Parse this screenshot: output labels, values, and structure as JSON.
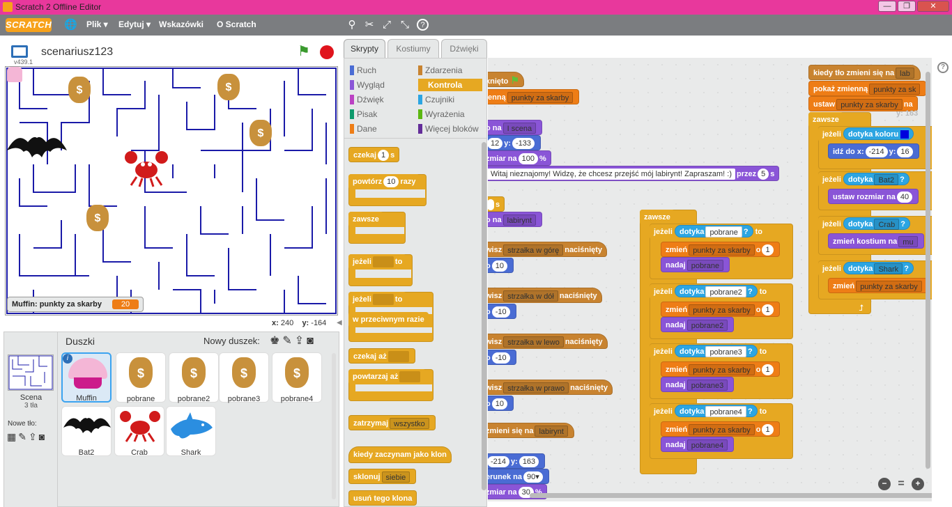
{
  "window": {
    "title": "Scratch 2 Offline Editor",
    "min": "—",
    "max": "❐",
    "close": "✕"
  },
  "menubar": {
    "logo": "SCRATCH",
    "items": [
      "Plik ▾",
      "Edytuj ▾",
      "Wskazówki",
      "O Scratch"
    ]
  },
  "stage": {
    "project_title": "scenariusz123",
    "version": "v439.1",
    "monitor_label": "Muffin: punkty za skarby",
    "monitor_value": "20",
    "x_label": "x:",
    "x_value": "240",
    "y_label": "y:",
    "y_value": "-164"
  },
  "sprites_pane": {
    "title": "Duszki",
    "new_sprite": "Nowy duszek:",
    "scene_label": "Scena",
    "scene_sub": "3 tła",
    "new_bg": "Nowe tło:",
    "sprites": [
      "Muffin",
      "pobrane",
      "pobrane2",
      "pobrane3",
      "pobrane4",
      "Bat2",
      "Crab",
      "Shark"
    ]
  },
  "tabs": [
    "Skrypty",
    "Kostiumy",
    "Dźwięki"
  ],
  "categories": [
    {
      "name": "Ruch",
      "color": "#4a6cd4"
    },
    {
      "name": "Zdarzenia",
      "color": "#c88330"
    },
    {
      "name": "Wygląd",
      "color": "#8a55d7"
    },
    {
      "name": "Kontrola",
      "color": "#e6a822"
    },
    {
      "name": "Dźwięk",
      "color": "#bb42c3"
    },
    {
      "name": "Czujniki",
      "color": "#2ca5e2"
    },
    {
      "name": "Pisak",
      "color": "#0e9a6c"
    },
    {
      "name": "Wyrażenia",
      "color": "#5cb712"
    },
    {
      "name": "Dane",
      "color": "#ee7d16"
    },
    {
      "name": "Więcej bloków",
      "color": "#632d99"
    }
  ],
  "palette": {
    "wait": "czekaj",
    "wait_val": "1",
    "wait_unit": "s",
    "repeat": "powtórz",
    "repeat_val": "10",
    "repeat_unit": "razy",
    "forever": "zawsze",
    "if": "jeżeli",
    "then": "to",
    "else": "w przeciwnym razie",
    "wait_until": "czekaj aż",
    "repeat_until": "powtarzaj aż",
    "stop": "zatrzymaj",
    "stop_opt": "wszystko",
    "clone_hat": "kiedy zaczynam jako klon",
    "clone": "sklonuj",
    "clone_opt": "siebie",
    "delete_clone": "usuń tego klona"
  },
  "scripts": {
    "a1": "knięto",
    "a2": "ienną",
    "a2v": "punkty za skarby",
    "a3": "o na",
    "a3v": "I scena",
    "a4v": "12",
    "a4y": "y:",
    "a4yv": "-133",
    "a5": "zmiar na",
    "a5v": "100",
    "a5u": "%",
    "a6v": "Witaj nieznajomy! Widzę, że chcesz przejść mój labirynt! Zapraszam! :)",
    "a6p": "przez",
    "a6n": "5",
    "a6s": "s",
    "a7": "s",
    "a8": "o na",
    "a8v": "labirynt",
    "k1": "wisz",
    "k1v": "strzałka w górę",
    "k1e": "naciśnięty",
    "k1n": "o",
    "k1nv": "10",
    "k2": "wisz",
    "k2v": "strzałka w dół",
    "k2e": "naciśnięty",
    "k2n": "o",
    "k2nv": "-10",
    "k3": "wisz",
    "k3v": "strzałka w lewo",
    "k3e": "naciśnięty",
    "k3n": "o",
    "k3nv": "-10",
    "k4": "wisz",
    "k4v": "strzałka w prawo",
    "k4e": "naciśnięty",
    "k4n": "o",
    "k4nv": "10",
    "b1": "zmieni się na",
    "b1v": "labirynt",
    "b2v": "-214",
    "b2y": "y:",
    "b2yv": "163",
    "b3": "erunek na",
    "b3v": "90▾",
    "b4": "zmiar na",
    "b4v": "30",
    "b4u": "%",
    "mid_forever": "zawsze",
    "if": "jeżeli",
    "touching": "dotyka",
    "q": "?",
    "then": "to",
    "change": "zmień",
    "change_var": "punkty za skarby",
    "by": "o",
    "by_val": "1",
    "wear": "nadaj",
    "items": [
      "pobrane",
      "pobrane2",
      "pobrane3",
      "pobrane4"
    ],
    "r1": "kiedy tło zmieni się na",
    "r1v": "lab",
    "r2": "pokaż zmienną",
    "r2v": "punkty za sk",
    "r3": "ustaw",
    "r3v": "punkty za skarby",
    "r3e": "na",
    "r_ghost": "y: 163",
    "r4": "zawsze",
    "r5": "jeżeli",
    "r5t": "dotyka koloru",
    "r6": "idź do x:",
    "r6v": "-214",
    "r6y": "y:",
    "r6yv": "16",
    "r7": "jeżeli",
    "r7t": "dotyka",
    "r7v": "Bat2",
    "r7q": "?",
    "r8": "ustaw rozmiar na",
    "r8v": "40",
    "r9": "jeżeli",
    "r9t": "dotyka",
    "r9v": "Crab",
    "r9q": "?",
    "r10": "zmień kostium na",
    "r10v": "mu",
    "r11": "jeżeli",
    "r11t": "dotyka",
    "r11v": "Shark",
    "r11q": "?",
    "r12": "zmień",
    "r12v": "punkty za skarby"
  },
  "zoom": {
    "out": "−",
    "reset": "=",
    "in": "+"
  },
  "help": "?"
}
